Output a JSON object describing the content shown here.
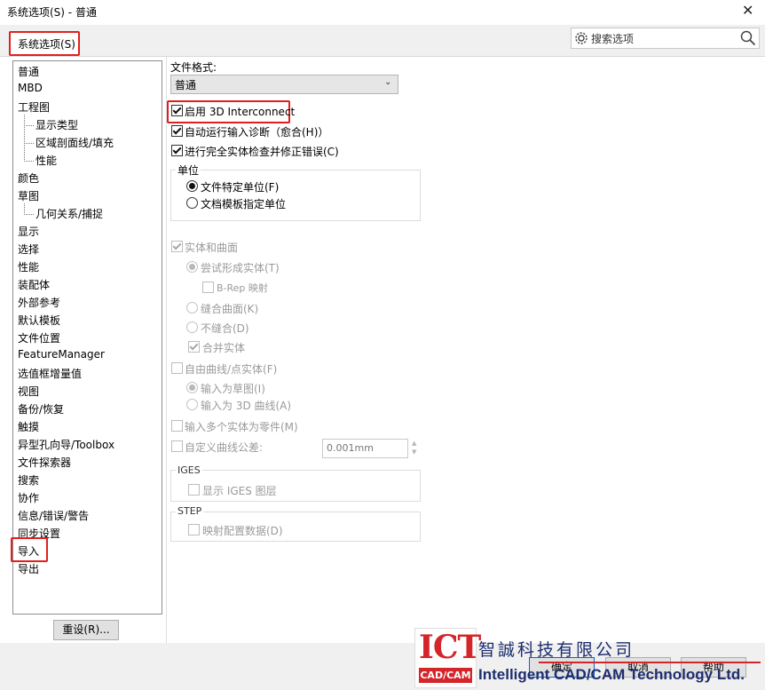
{
  "window": {
    "title": "系统选项(S) - 普通",
    "close_glyph": "✕"
  },
  "tab": {
    "label": "系统选项(S)"
  },
  "search": {
    "placeholder": "搜索选项"
  },
  "tree": {
    "items": [
      {
        "label": "普通",
        "level": 0,
        "selected": true
      },
      {
        "label": "MBD",
        "level": 0
      },
      {
        "label": "工程图",
        "level": 0
      },
      {
        "label": "显示类型",
        "level": 1
      },
      {
        "label": "区域剖面线/填充",
        "level": 1
      },
      {
        "label": "性能",
        "level": 1
      },
      {
        "label": "颜色",
        "level": 0
      },
      {
        "label": "草图",
        "level": 0
      },
      {
        "label": "几何关系/捕捉",
        "level": 1
      },
      {
        "label": "显示",
        "level": 0
      },
      {
        "label": "选择",
        "level": 0
      },
      {
        "label": "性能",
        "level": 0
      },
      {
        "label": "装配体",
        "level": 0
      },
      {
        "label": "外部参考",
        "level": 0
      },
      {
        "label": "默认模板",
        "level": 0
      },
      {
        "label": "文件位置",
        "level": 0
      },
      {
        "label": "FeatureManager",
        "level": 0
      },
      {
        "label": "选值框增量值",
        "level": 0
      },
      {
        "label": "视图",
        "level": 0
      },
      {
        "label": "备份/恢复",
        "level": 0
      },
      {
        "label": "触摸",
        "level": 0
      },
      {
        "label": "异型孔向导/Toolbox",
        "level": 0
      },
      {
        "label": "文件探索器",
        "level": 0
      },
      {
        "label": "搜索",
        "level": 0
      },
      {
        "label": "协作",
        "level": 0
      },
      {
        "label": "信息/错误/警告",
        "level": 0
      },
      {
        "label": "同步设置",
        "level": 0
      },
      {
        "label": "导入",
        "level": 0
      },
      {
        "label": "导出",
        "level": 0
      }
    ]
  },
  "reset_button": "重设(R)...",
  "file_format": {
    "label": "文件格式:",
    "value": "普通"
  },
  "options": {
    "enable_3d_interconnect": {
      "label": "启用 3D Interconnect",
      "checked": true
    },
    "auto_diagnose": {
      "label": "自动运行输入诊断（愈合(H)）",
      "checked": true
    },
    "full_check": {
      "label": "进行完全实体检查并修正错误(C)",
      "checked": true
    }
  },
  "units": {
    "title": "单位",
    "file_units": {
      "label": "文件特定单位(F)",
      "selected": true
    },
    "template_units": {
      "label": "文档模板指定单位",
      "selected": false
    }
  },
  "solids": {
    "label": "实体和曲面",
    "try_solid": "尝试形成实体(T)",
    "brep": "B-Rep 映射",
    "knit": "缝合曲面(K)",
    "no_knit": "不缝合(D)",
    "merge": "合并实体"
  },
  "free_curves": {
    "label": "自由曲线/点实体(F)",
    "as_sketch": "输入为草图(I)",
    "as_3d_curve": "输入为 3D 曲线(A)"
  },
  "multi_body": "输入多个实体为零件(M)",
  "custom_tolerance": {
    "label": "自定义曲线公差:",
    "value": "0.001mm"
  },
  "iges": {
    "title": "IGES",
    "show_layers": "显示 IGES 图层"
  },
  "step": {
    "title": "STEP",
    "map_config": "映射配置数据(D)"
  },
  "buttons": {
    "ok": "确定",
    "cancel": "取消",
    "help": "帮助"
  },
  "logo": {
    "mark": "ICT",
    "sub": "CAD/CAM",
    "cn_name": "智誠科技有限公司",
    "en_name": "Intelligent CAD/CAM Technology Ltd."
  },
  "colors": {
    "highlight_red": "#e0201e",
    "logo_red": "#d4252a",
    "logo_navy": "#1d2d6e"
  }
}
